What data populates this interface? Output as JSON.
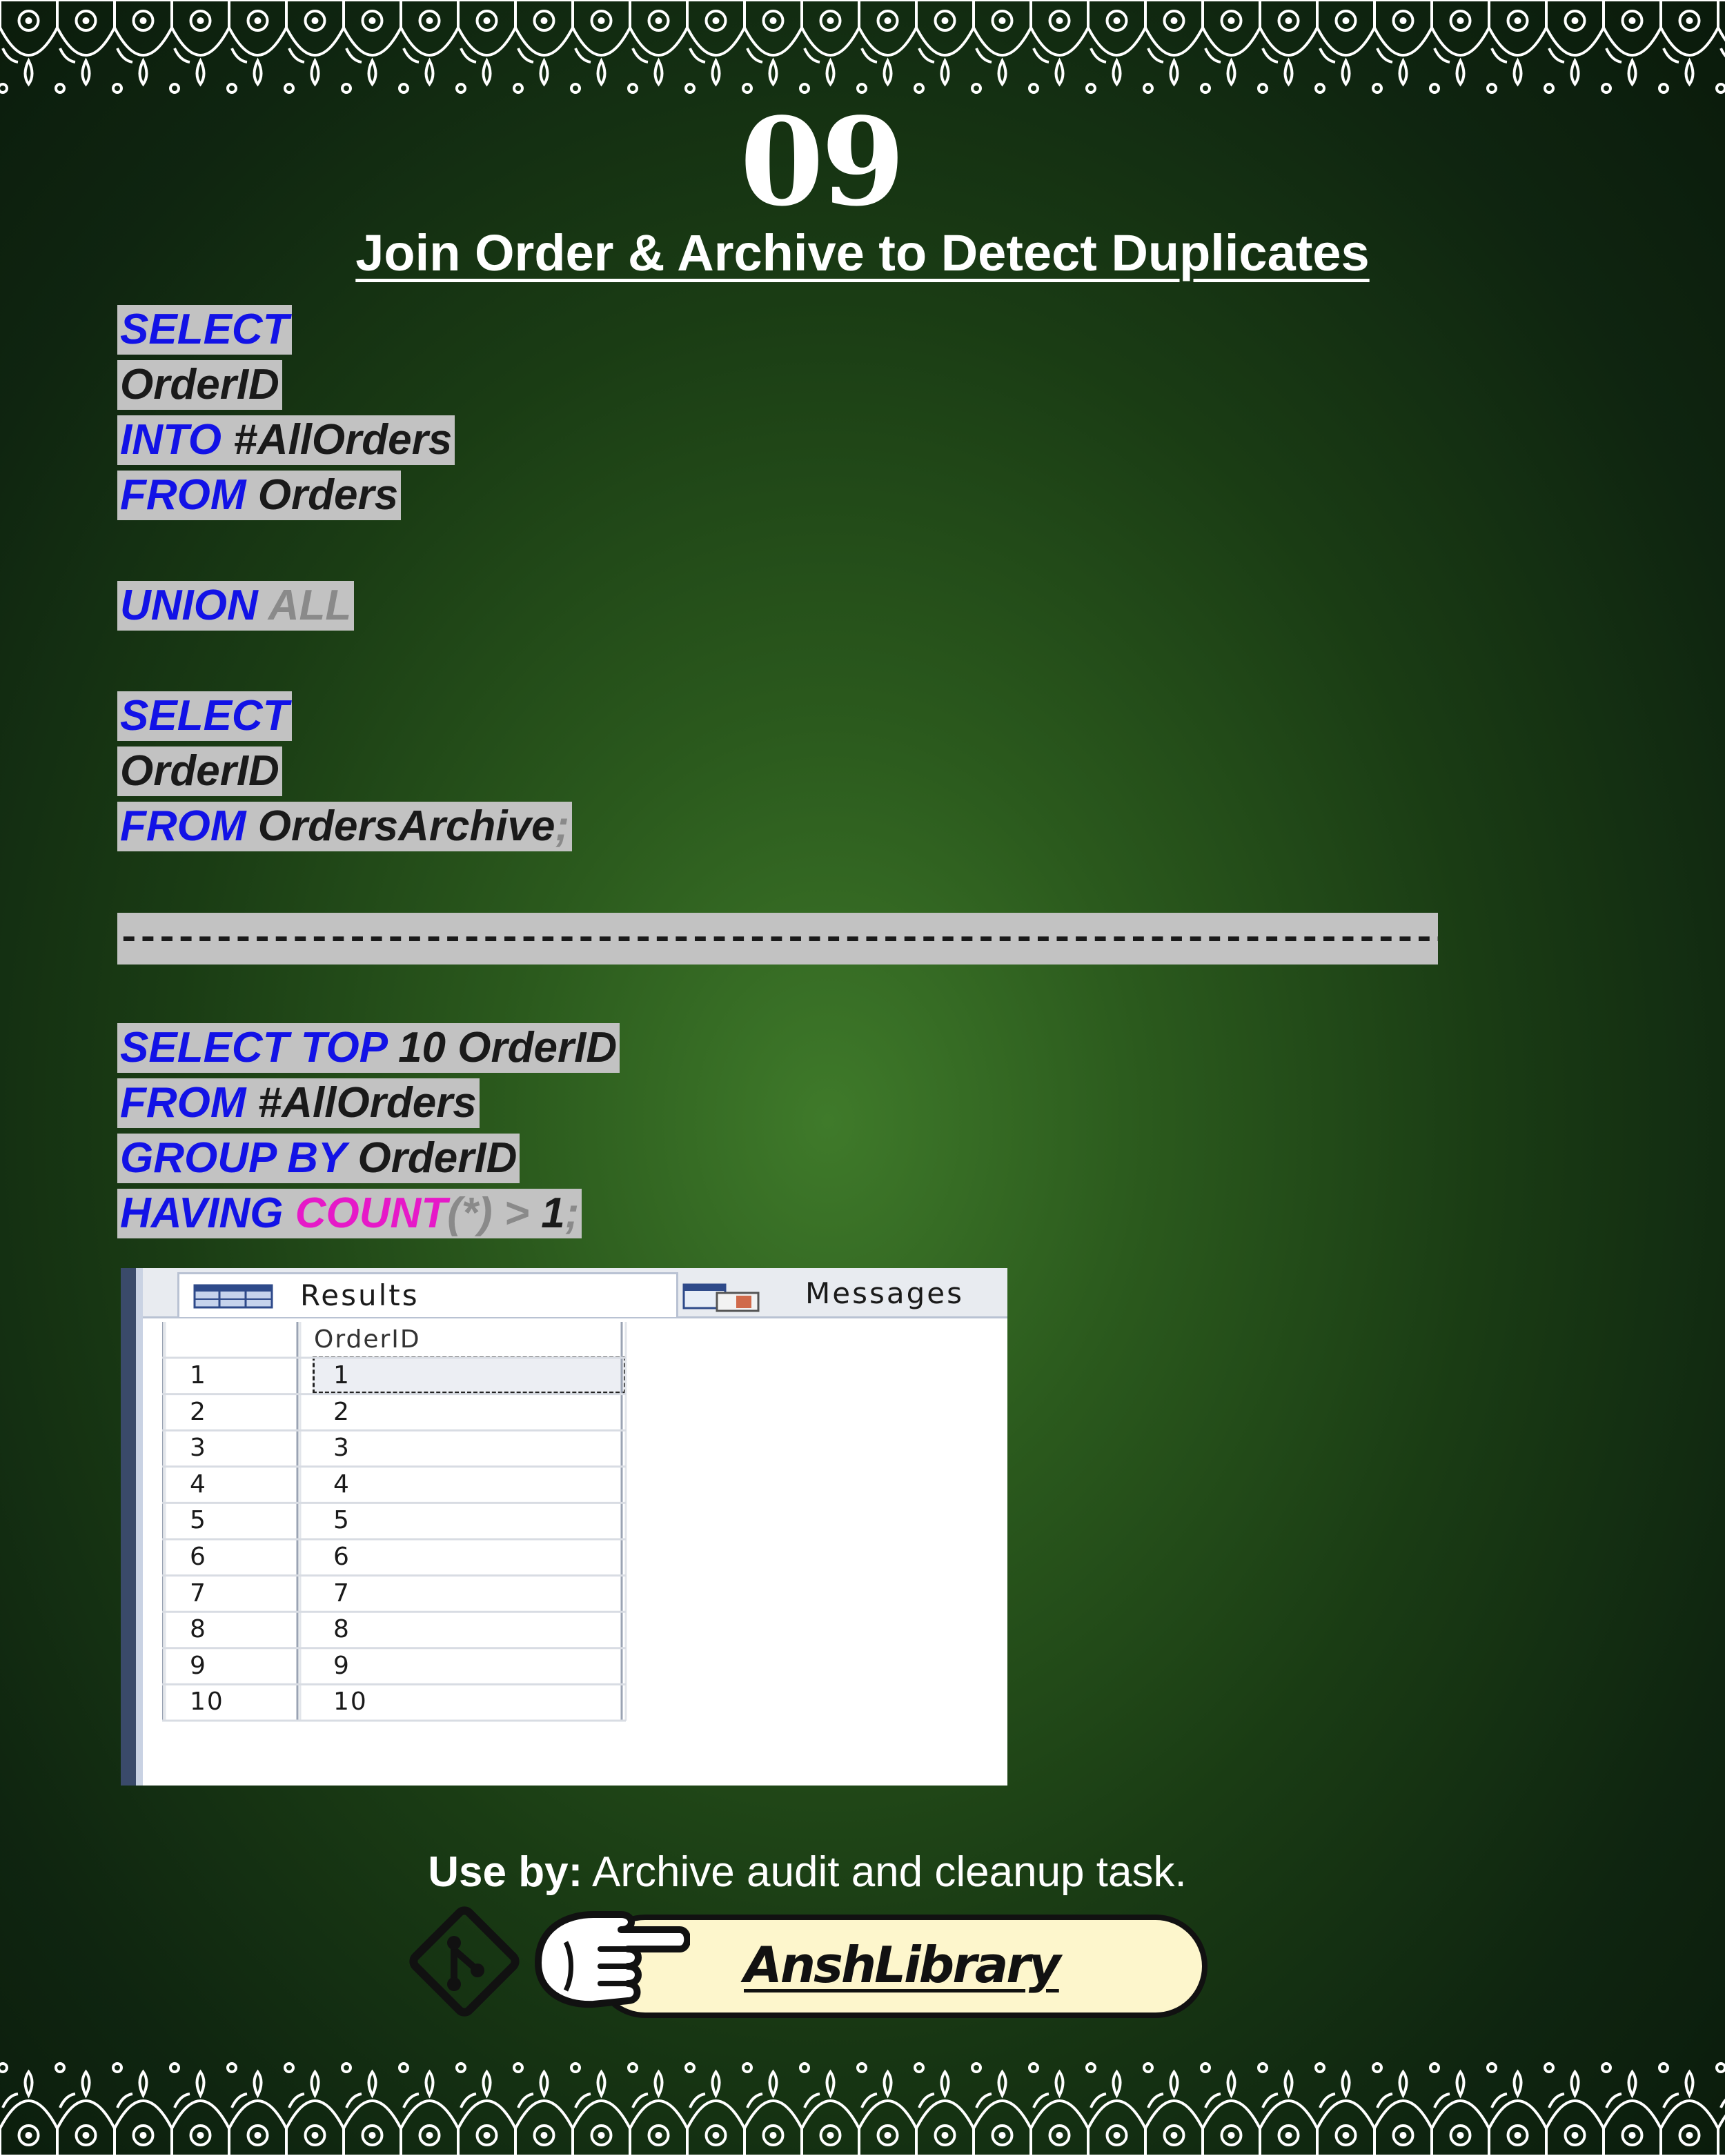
{
  "page": {
    "number": "09",
    "title": "Join Order & Archive to Detect Duplicates"
  },
  "code_block_1": {
    "line1_kw": "SELECT",
    "line2_id": "OrderID",
    "line3_kw": "INTO",
    "line3_id": " #AllOrders",
    "line4_kw": "FROM",
    "line4_id": " Orders",
    "line5_kw": "UNION",
    "line5_gr": " ALL",
    "line6_kw": "SELECT",
    "line7_id": "OrderID",
    "line8_kw": "FROM",
    "line8_id": " OrdersArchive",
    "line8_gr": ";"
  },
  "separator": "------------------------------------------------------------------------------------------------------------------------------------------------------------",
  "code_block_2": {
    "line1_kw": "SELECT TOP",
    "line1_id": " 10 OrderID",
    "line2_kw": "FROM",
    "line2_id": " #AllOrders",
    "line3_kw": "GROUP BY",
    "line3_id": " OrderID",
    "line4_kw": "HAVING ",
    "line4_fn": "COUNT",
    "line4_gr": "(*) > ",
    "line4_id": "1",
    "line4_end": ";"
  },
  "results": {
    "tabs": [
      "Results",
      "Messages"
    ],
    "column_header": "OrderID",
    "rows": [
      {
        "n": "1",
        "v": "1"
      },
      {
        "n": "2",
        "v": "2"
      },
      {
        "n": "3",
        "v": "3"
      },
      {
        "n": "4",
        "v": "4"
      },
      {
        "n": "5",
        "v": "5"
      },
      {
        "n": "6",
        "v": "6"
      },
      {
        "n": "7",
        "v": "7"
      },
      {
        "n": "8",
        "v": "8"
      },
      {
        "n": "9",
        "v": "9"
      },
      {
        "n": "10",
        "v": "10"
      }
    ]
  },
  "footer": {
    "use_by_label": "Use by:",
    "use_by_text": " Archive audit and cleanup task."
  },
  "brand": {
    "name": "AnshLibrary"
  },
  "icons": {
    "git": "git-icon",
    "hand": "pointing-hand-icon",
    "results_tab": "grid-icon",
    "messages_tab": "messages-icon"
  },
  "colors": {
    "keyword": "#1212e6",
    "function": "#e619c8",
    "operator": "#8a8a8a",
    "code_highlight": "#c2c2c2",
    "brand_pill": "#fdf6cc"
  }
}
